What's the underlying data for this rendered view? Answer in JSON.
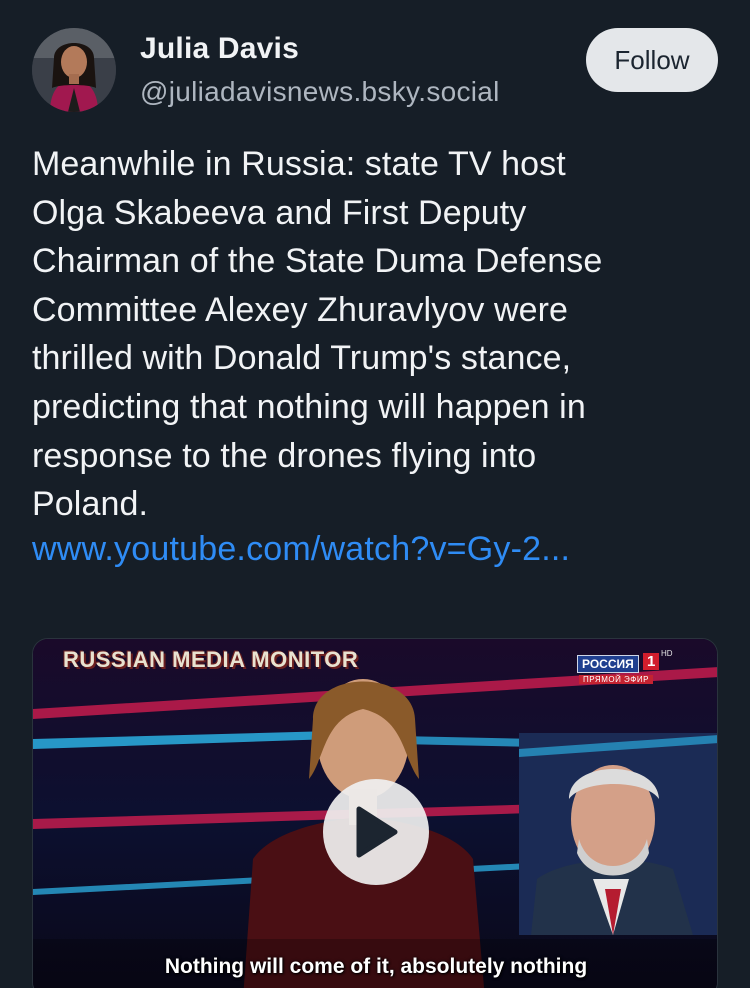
{
  "author": {
    "display_name": "Julia Davis",
    "handle": "@juliadavisnews.bsky.social",
    "avatar_icon": "profile-photo"
  },
  "follow_button": {
    "label": "Follow"
  },
  "post": {
    "text_lines": [
      "Meanwhile in Russia: state TV host",
      "Olga Skabeeva and First Deputy",
      "Chairman of the State Duma Defense",
      "Committee Alexey Zhuravlyov were",
      "thrilled with Donald Trump's stance,",
      "predicting that nothing will happen in",
      "response to the drones flying into",
      "Poland."
    ],
    "link": "www.youtube.com/watch?v=Gy-2..."
  },
  "video": {
    "watermark": "RUSSIAN MEDIA MONITOR",
    "channel": {
      "name": "РОССИЯ",
      "number": "1",
      "hd": "HD",
      "live": "ПРЯМОЙ ЭФИР"
    },
    "subtitle": "Nothing will come of it, absolutely nothing",
    "play_icon": "play-icon"
  },
  "colors": {
    "background": "#161e27",
    "link": "#2f8cf5",
    "follow_bg": "#e4e7ea"
  }
}
